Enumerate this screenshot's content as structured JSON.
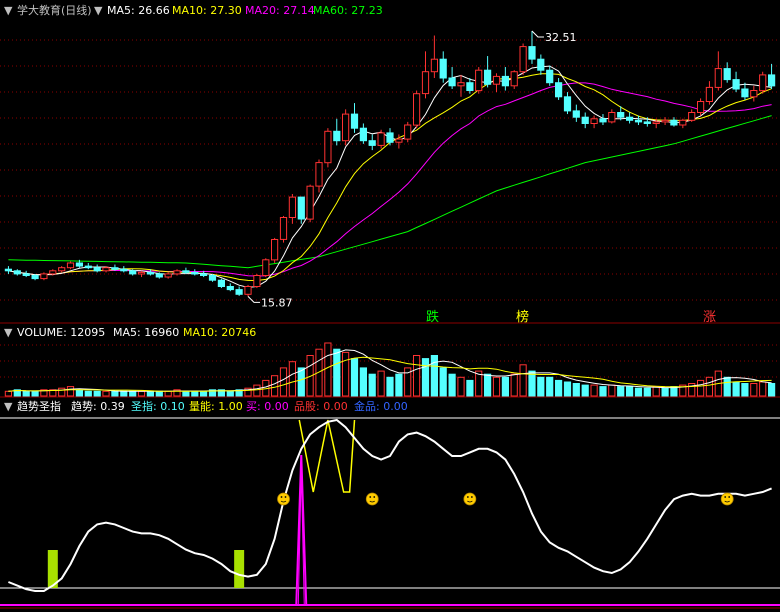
{
  "colors": {
    "bg": "#000000",
    "up": "#ff3232",
    "down": "#54ffff",
    "ma5": "#ffffff",
    "ma10": "#ffff00",
    "ma20": "#ff00ff",
    "ma60": "#00ff00",
    "grid": "#8b0000",
    "white_line": "#ffffff",
    "pink": "#ff00ff",
    "yellow_bar": "#a8e000"
  },
  "price_panel": {
    "title": "学大教育(日线)",
    "ma_labels": [
      {
        "name": "MA5",
        "value": "26.66",
        "color": "#ffffff"
      },
      {
        "name": "MA10",
        "value": "27.30",
        "color": "#ffff00"
      },
      {
        "name": "MA20",
        "value": "27.14",
        "color": "#ff00ff"
      },
      {
        "name": "MA60",
        "value": "27.23",
        "color": "#00ff00"
      }
    ],
    "max_annotation": "32.51",
    "min_annotation": "15.87",
    "signals": [
      {
        "text": "跌",
        "color": "#00ff00"
      },
      {
        "text": "榜",
        "color": "#ffff00"
      },
      {
        "text": "涨",
        "color": "#ff3232"
      }
    ]
  },
  "volume_panel": {
    "label": "VOLUME: 12095",
    "ma5_label": "MA5: 16960",
    "ma10_label": "MA10: 20746"
  },
  "indicator_panel": {
    "title": "趋势圣指",
    "items": [
      {
        "label": "趋势: 0.39",
        "color": "#ffffff"
      },
      {
        "label": "圣指: 0.10",
        "color": "#54ffff"
      },
      {
        "label": "量能: 1.00",
        "color": "#ffff00"
      },
      {
        "label": "买: 0.00",
        "color": "#ff00ff"
      },
      {
        "label": "品股: 0.00",
        "color": "#ff3232"
      },
      {
        "label": "金品: 0.00",
        "color": "#3264ff"
      }
    ]
  },
  "chart_data": {
    "type": "candlestick",
    "ylim": [
      15.0,
      33.5
    ],
    "grid": true,
    "candles": [
      [
        17.6,
        17.8,
        17.3,
        17.5
      ],
      [
        17.5,
        17.6,
        17.2,
        17.3
      ],
      [
        17.3,
        17.5,
        17.1,
        17.2
      ],
      [
        17.2,
        17.3,
        16.9,
        17.0
      ],
      [
        17.0,
        17.4,
        16.9,
        17.3
      ],
      [
        17.3,
        17.6,
        17.2,
        17.5
      ],
      [
        17.5,
        17.8,
        17.4,
        17.7
      ],
      [
        17.7,
        18.1,
        17.6,
        18.0
      ],
      [
        18.0,
        18.2,
        17.7,
        17.8
      ],
      [
        17.8,
        18.0,
        17.6,
        17.7
      ],
      [
        17.7,
        17.9,
        17.4,
        17.5
      ],
      [
        17.5,
        17.8,
        17.4,
        17.7
      ],
      [
        17.7,
        17.9,
        17.5,
        17.6
      ],
      [
        17.6,
        17.8,
        17.4,
        17.5
      ],
      [
        17.5,
        17.6,
        17.2,
        17.3
      ],
      [
        17.3,
        17.5,
        17.1,
        17.4
      ],
      [
        17.4,
        17.6,
        17.2,
        17.3
      ],
      [
        17.3,
        17.4,
        17.0,
        17.1
      ],
      [
        17.1,
        17.4,
        17.0,
        17.3
      ],
      [
        17.3,
        17.6,
        17.2,
        17.5
      ],
      [
        17.5,
        17.7,
        17.3,
        17.4
      ],
      [
        17.4,
        17.6,
        17.2,
        17.3
      ],
      [
        17.3,
        17.5,
        17.1,
        17.2
      ],
      [
        17.2,
        17.3,
        16.8,
        16.9
      ],
      [
        16.9,
        17.0,
        16.4,
        16.5
      ],
      [
        16.5,
        16.7,
        16.2,
        16.3
      ],
      [
        16.3,
        16.5,
        15.9,
        16.0
      ],
      [
        16.0,
        16.6,
        15.87,
        16.5
      ],
      [
        16.5,
        17.3,
        16.4,
        17.2
      ],
      [
        17.2,
        18.3,
        17.1,
        18.2
      ],
      [
        18.2,
        19.6,
        18.0,
        19.5
      ],
      [
        19.5,
        21.0,
        19.3,
        20.9
      ],
      [
        20.9,
        22.4,
        20.5,
        22.2
      ],
      [
        22.2,
        21.6,
        20.5,
        20.8
      ],
      [
        20.8,
        23.0,
        20.6,
        22.9
      ],
      [
        22.9,
        24.6,
        22.5,
        24.4
      ],
      [
        24.4,
        26.6,
        24.1,
        26.4
      ],
      [
        26.4,
        27.2,
        25.5,
        25.8
      ],
      [
        25.8,
        27.8,
        25.5,
        27.5
      ],
      [
        27.5,
        28.2,
        26.3,
        26.6
      ],
      [
        26.6,
        26.9,
        25.6,
        25.8
      ],
      [
        25.8,
        26.2,
        25.2,
        25.5
      ],
      [
        25.5,
        26.5,
        25.3,
        26.3
      ],
      [
        26.3,
        26.6,
        25.5,
        25.7
      ],
      [
        25.7,
        26.2,
        25.3,
        25.9
      ],
      [
        25.9,
        27.0,
        25.7,
        26.8
      ],
      [
        26.8,
        29.0,
        26.6,
        28.8
      ],
      [
        28.8,
        31.5,
        28.5,
        30.2
      ],
      [
        30.2,
        32.51,
        29.8,
        31.0
      ],
      [
        31.0,
        31.5,
        29.5,
        29.8
      ],
      [
        29.8,
        30.5,
        29.1,
        29.3
      ],
      [
        29.3,
        30.0,
        28.6,
        29.5
      ],
      [
        29.5,
        29.8,
        28.8,
        29.0
      ],
      [
        29.0,
        30.5,
        28.8,
        30.3
      ],
      [
        30.3,
        31.2,
        29.2,
        29.4
      ],
      [
        29.4,
        30.1,
        28.9,
        29.9
      ],
      [
        29.9,
        30.5,
        29.0,
        29.3
      ],
      [
        29.3,
        30.3,
        29.1,
        30.2
      ],
      [
        30.2,
        32.0,
        30.0,
        31.8
      ],
      [
        31.8,
        32.8,
        30.7,
        31.0
      ],
      [
        31.0,
        31.3,
        30.0,
        30.3
      ],
      [
        30.3,
        30.6,
        29.3,
        29.5
      ],
      [
        29.5,
        29.8,
        28.4,
        28.6
      ],
      [
        28.6,
        28.9,
        27.5,
        27.7
      ],
      [
        27.7,
        28.1,
        27.0,
        27.3
      ],
      [
        27.3,
        27.6,
        26.6,
        26.9
      ],
      [
        26.9,
        27.4,
        26.6,
        27.2
      ],
      [
        27.2,
        27.5,
        26.8,
        27.0
      ],
      [
        27.0,
        27.8,
        26.9,
        27.6
      ],
      [
        27.6,
        28.0,
        27.1,
        27.3
      ],
      [
        27.3,
        27.6,
        26.9,
        27.1
      ],
      [
        27.1,
        27.4,
        26.8,
        27.0
      ],
      [
        27.0,
        27.3,
        26.7,
        26.9
      ],
      [
        26.9,
        27.2,
        26.6,
        27.0
      ],
      [
        27.0,
        27.3,
        26.8,
        27.1
      ],
      [
        27.1,
        27.3,
        26.7,
        26.8
      ],
      [
        26.8,
        27.2,
        26.6,
        27.1
      ],
      [
        27.1,
        27.8,
        27.0,
        27.6
      ],
      [
        27.6,
        28.5,
        27.4,
        28.3
      ],
      [
        28.3,
        29.6,
        28.1,
        29.2
      ],
      [
        29.2,
        31.5,
        29.0,
        30.4
      ],
      [
        30.4,
        30.8,
        29.5,
        29.7
      ],
      [
        29.7,
        30.2,
        28.9,
        29.1
      ],
      [
        29.1,
        29.5,
        28.4,
        28.6
      ],
      [
        28.6,
        29.3,
        28.3,
        29.0
      ],
      [
        29.0,
        30.2,
        28.8,
        30.0
      ],
      [
        30.0,
        30.7,
        29.1,
        29.3
      ]
    ],
    "ma60_anchor_points": [
      [
        0,
        18.2
      ],
      [
        20,
        18.0
      ],
      [
        27,
        17.7
      ],
      [
        35,
        18.4
      ],
      [
        45,
        20.0
      ],
      [
        55,
        22.6
      ],
      [
        65,
        24.4
      ],
      [
        75,
        25.6
      ],
      [
        86,
        27.4
      ]
    ],
    "volume": [
      {
        "v": 3,
        "up": true
      },
      {
        "v": 4,
        "up": false
      },
      {
        "v": 3,
        "up": false
      },
      {
        "v": 3,
        "up": false
      },
      {
        "v": 4,
        "up": true
      },
      {
        "v": 4,
        "up": true
      },
      {
        "v": 5,
        "up": true
      },
      {
        "v": 6,
        "up": true
      },
      {
        "v": 4,
        "up": false
      },
      {
        "v": 3,
        "up": false
      },
      {
        "v": 3,
        "up": false
      },
      {
        "v": 3,
        "up": true
      },
      {
        "v": 3,
        "up": false
      },
      {
        "v": 3,
        "up": false
      },
      {
        "v": 3,
        "up": false
      },
      {
        "v": 3,
        "up": true
      },
      {
        "v": 3,
        "up": false
      },
      {
        "v": 3,
        "up": false
      },
      {
        "v": 3,
        "up": true
      },
      {
        "v": 4,
        "up": true
      },
      {
        "v": 3,
        "up": false
      },
      {
        "v": 3,
        "up": false
      },
      {
        "v": 3,
        "up": false
      },
      {
        "v": 4,
        "up": false
      },
      {
        "v": 4,
        "up": false
      },
      {
        "v": 3,
        "up": false
      },
      {
        "v": 4,
        "up": false
      },
      {
        "v": 5,
        "up": true
      },
      {
        "v": 7,
        "up": true
      },
      {
        "v": 10,
        "up": true
      },
      {
        "v": 13,
        "up": true
      },
      {
        "v": 18,
        "up": true
      },
      {
        "v": 22,
        "up": true
      },
      {
        "v": 18,
        "up": false
      },
      {
        "v": 26,
        "up": true
      },
      {
        "v": 30,
        "up": true
      },
      {
        "v": 34,
        "up": true
      },
      {
        "v": 30,
        "up": false
      },
      {
        "v": 28,
        "up": true
      },
      {
        "v": 24,
        "up": false
      },
      {
        "v": 18,
        "up": false
      },
      {
        "v": 14,
        "up": false
      },
      {
        "v": 16,
        "up": true
      },
      {
        "v": 12,
        "up": false
      },
      {
        "v": 14,
        "up": false
      },
      {
        "v": 18,
        "up": true
      },
      {
        "v": 26,
        "up": true
      },
      {
        "v": 24,
        "up": false
      },
      {
        "v": 26,
        "up": false
      },
      {
        "v": 18,
        "up": false
      },
      {
        "v": 14,
        "up": false
      },
      {
        "v": 12,
        "up": true
      },
      {
        "v": 10,
        "up": false
      },
      {
        "v": 16,
        "up": true
      },
      {
        "v": 14,
        "up": false
      },
      {
        "v": 12,
        "up": true
      },
      {
        "v": 12,
        "up": false
      },
      {
        "v": 14,
        "up": true
      },
      {
        "v": 20,
        "up": true
      },
      {
        "v": 16,
        "up": false
      },
      {
        "v": 12,
        "up": false
      },
      {
        "v": 12,
        "up": false
      },
      {
        "v": 10,
        "up": false
      },
      {
        "v": 9,
        "up": false
      },
      {
        "v": 8,
        "up": false
      },
      {
        "v": 7,
        "up": false
      },
      {
        "v": 7,
        "up": true
      },
      {
        "v": 6,
        "up": false
      },
      {
        "v": 7,
        "up": true
      },
      {
        "v": 6,
        "up": false
      },
      {
        "v": 6,
        "up": false
      },
      {
        "v": 5,
        "up": false
      },
      {
        "v": 5,
        "up": false
      },
      {
        "v": 6,
        "up": true
      },
      {
        "v": 5,
        "up": false
      },
      {
        "v": 6,
        "up": false
      },
      {
        "v": 7,
        "up": true
      },
      {
        "v": 8,
        "up": true
      },
      {
        "v": 10,
        "up": true
      },
      {
        "v": 12,
        "up": true
      },
      {
        "v": 16,
        "up": true
      },
      {
        "v": 12,
        "up": false
      },
      {
        "v": 9,
        "up": false
      },
      {
        "v": 8,
        "up": false
      },
      {
        "v": 8,
        "up": true
      },
      {
        "v": 9,
        "up": true
      },
      {
        "v": 8,
        "up": false
      }
    ],
    "trend_line": [
      0.1,
      0.08,
      0.06,
      0.05,
      0.05,
      0.08,
      0.12,
      0.2,
      0.3,
      0.38,
      0.42,
      0.43,
      0.42,
      0.4,
      0.38,
      0.37,
      0.37,
      0.36,
      0.34,
      0.31,
      0.28,
      0.26,
      0.25,
      0.23,
      0.2,
      0.16,
      0.14,
      0.13,
      0.14,
      0.2,
      0.34,
      0.55,
      0.72,
      0.84,
      0.92,
      0.96,
      0.99,
      1.0,
      0.96,
      0.9,
      0.84,
      0.8,
      0.78,
      0.8,
      0.88,
      0.92,
      0.93,
      0.91,
      0.88,
      0.84,
      0.8,
      0.8,
      0.82,
      0.84,
      0.84,
      0.82,
      0.78,
      0.7,
      0.6,
      0.48,
      0.38,
      0.32,
      0.29,
      0.27,
      0.24,
      0.21,
      0.18,
      0.16,
      0.15,
      0.17,
      0.21,
      0.27,
      0.34,
      0.42,
      0.5,
      0.56,
      0.58,
      0.59,
      0.58,
      0.58,
      0.59,
      0.59,
      0.59,
      0.58,
      0.59,
      0.6,
      0.62
    ]
  }
}
